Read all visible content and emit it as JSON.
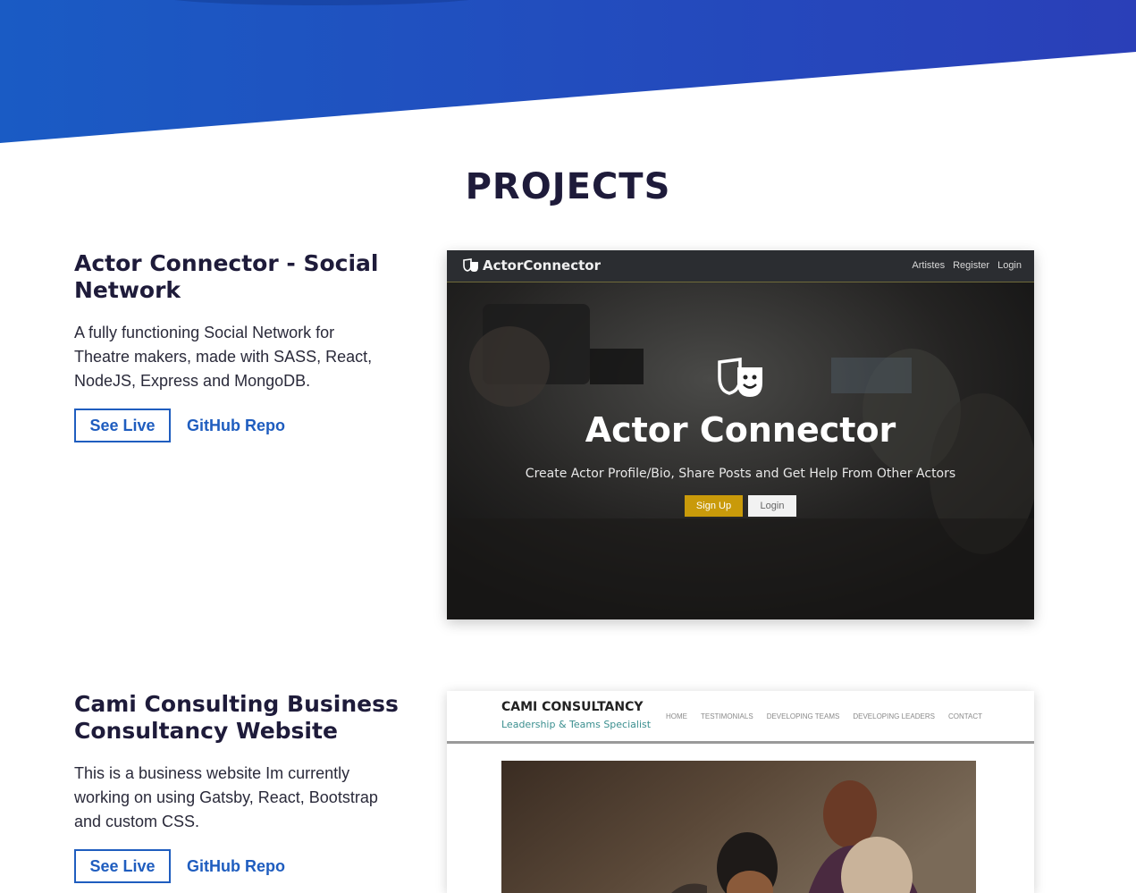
{
  "section": {
    "title": "PROJECTS"
  },
  "projects": [
    {
      "title": "Actor Connector - Social Network",
      "description": "A fully functioning Social Network for Theatre makers, made with SASS, React, NodeJS, Express and MongoDB.",
      "live_label": "See Live",
      "repo_label": "GitHub Repo",
      "preview": {
        "brand": "ActorConnector",
        "nav": [
          "Artistes",
          "Register",
          "Login"
        ],
        "title": "Actor Connector",
        "tagline": "Create Actor Profile/Bio, Share Posts and Get Help From Other Actors",
        "signup_label": "Sign Up",
        "login_label": "Login"
      }
    },
    {
      "title": "Cami Consulting Business Consultancy Website",
      "description": "This is a business website Im currently working on using Gatsby, React, Bootstrap and custom CSS.",
      "live_label": "See Live",
      "repo_label": "GitHub Repo",
      "preview": {
        "brand": "CAMI CONSULTANCY",
        "subtitle": "Leadership & Teams Specialist",
        "nav": [
          "HOME",
          "TESTIMONIALS",
          "DEVELOPING TEAMS",
          "DEVELOPING LEADERS",
          "CONTACT"
        ]
      }
    }
  ],
  "colors": {
    "accent": "#1f5dbf",
    "hero_start": "#1a5bc4",
    "hero_end": "#2a3fb8",
    "heading": "#1e1b3a",
    "gold": "#c99a0a"
  }
}
